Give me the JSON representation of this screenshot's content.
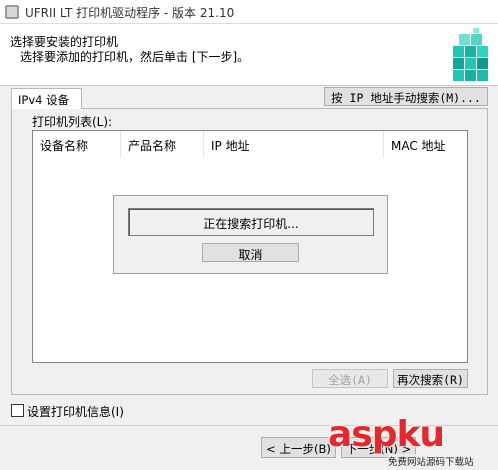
{
  "window": {
    "title": "UFRII LT 打印机驱动程序 - 版本 21.10"
  },
  "header": {
    "title": "选择要安装的打印机",
    "subtitle": "选择要添加的打印机，然后单击 [下一步]。"
  },
  "tab": {
    "label": "IPv4 设备"
  },
  "search_by_ip_button": "按 IP 地址手动搜索(M)...",
  "printer_list": {
    "label": "打印机列表(L):",
    "columns": [
      "设备名称",
      "产品名称",
      "IP 地址",
      "MAC 地址"
    ]
  },
  "progress_dialog": {
    "status": "正在搜索打印机...",
    "cancel_label": "取消"
  },
  "select_all_button": "全选(A)",
  "research_button": "再次搜索(R)",
  "set_info_checkbox": {
    "label": "设置打印机信息(I)",
    "checked": false
  },
  "footer": {
    "back_button": "< 上一步(B)",
    "next_button_partial": "下一步(N) >"
  },
  "watermark": {
    "main": "aspku",
    "sub": "免费网站源码下载站",
    "main_color": "#e8262c"
  }
}
